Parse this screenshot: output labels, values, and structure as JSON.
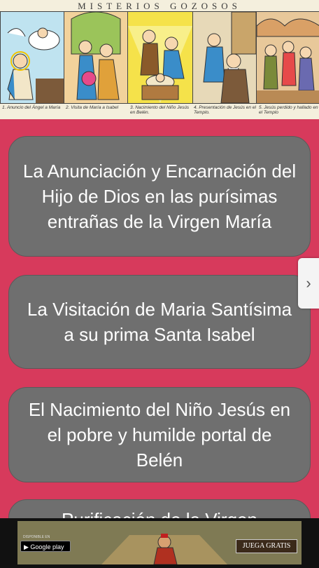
{
  "header": {
    "title": "MISTERIOS GOZOSOS",
    "captions": [
      "1. Anuncio del Ángel a María",
      "2. Visita de María a Isabel",
      "3. Nacimiento del Niño Jesús en Belén.",
      "4. Presentación de Jesús en el Templo.",
      "5. Jesús perdido y hallado en el Templo"
    ]
  },
  "mysteries": [
    "La Anunciación y Encarnación del Hijo de Dios en las purísimas entrañas de la Virgen María",
    "La Visitación de Maria Santísima a su prima Santa Isabel",
    "El Nacimiento del Niño Jesús en el pobre y humilde portal de Belén",
    "Purificación de la Virgen"
  ],
  "nav": {
    "next_icon": "›"
  },
  "ad": {
    "store_small": "DISPONIBLE EN",
    "store": "Google play",
    "cta": "JUEGA GRATIS"
  },
  "colors": {
    "background": "#d73a5c",
    "card": "#6f6f6f"
  }
}
